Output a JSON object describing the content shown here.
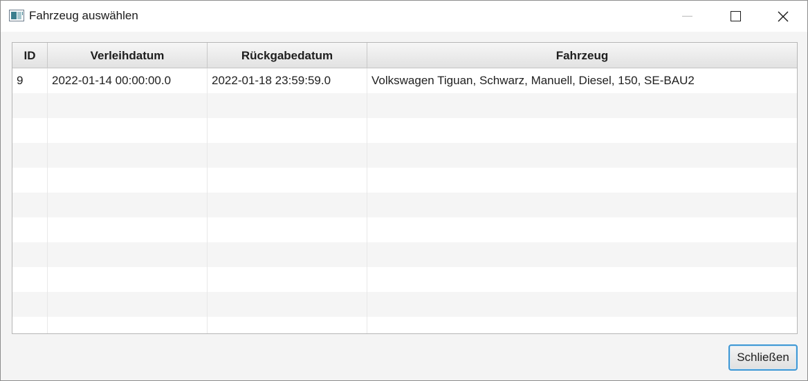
{
  "window": {
    "title": "Fahrzeug auswählen",
    "controls": [
      "minimize-icon",
      "maximize-icon",
      "close-icon"
    ]
  },
  "table": {
    "columns": [
      "ID",
      "Verleihdatum",
      "Rückgabedatum",
      "Fahrzeug"
    ],
    "rows": [
      [
        "9",
        "2022-01-14 00:00:00.0",
        "2022-01-18 23:59:59.0",
        "Volkswagen Tiguan, Schwarz, Manuell, Diesel, 150, SE-BAU2"
      ],
      [
        "",
        "",
        "",
        ""
      ],
      [
        "",
        "",
        "",
        ""
      ],
      [
        "",
        "",
        "",
        ""
      ],
      [
        "",
        "",
        "",
        ""
      ],
      [
        "",
        "",
        "",
        ""
      ],
      [
        "",
        "",
        "",
        ""
      ],
      [
        "",
        "",
        "",
        ""
      ],
      [
        "",
        "",
        "",
        ""
      ],
      [
        "",
        "",
        "",
        ""
      ],
      [
        "",
        "",
        "",
        ""
      ]
    ]
  },
  "footer": {
    "close_label": "Schließen"
  }
}
